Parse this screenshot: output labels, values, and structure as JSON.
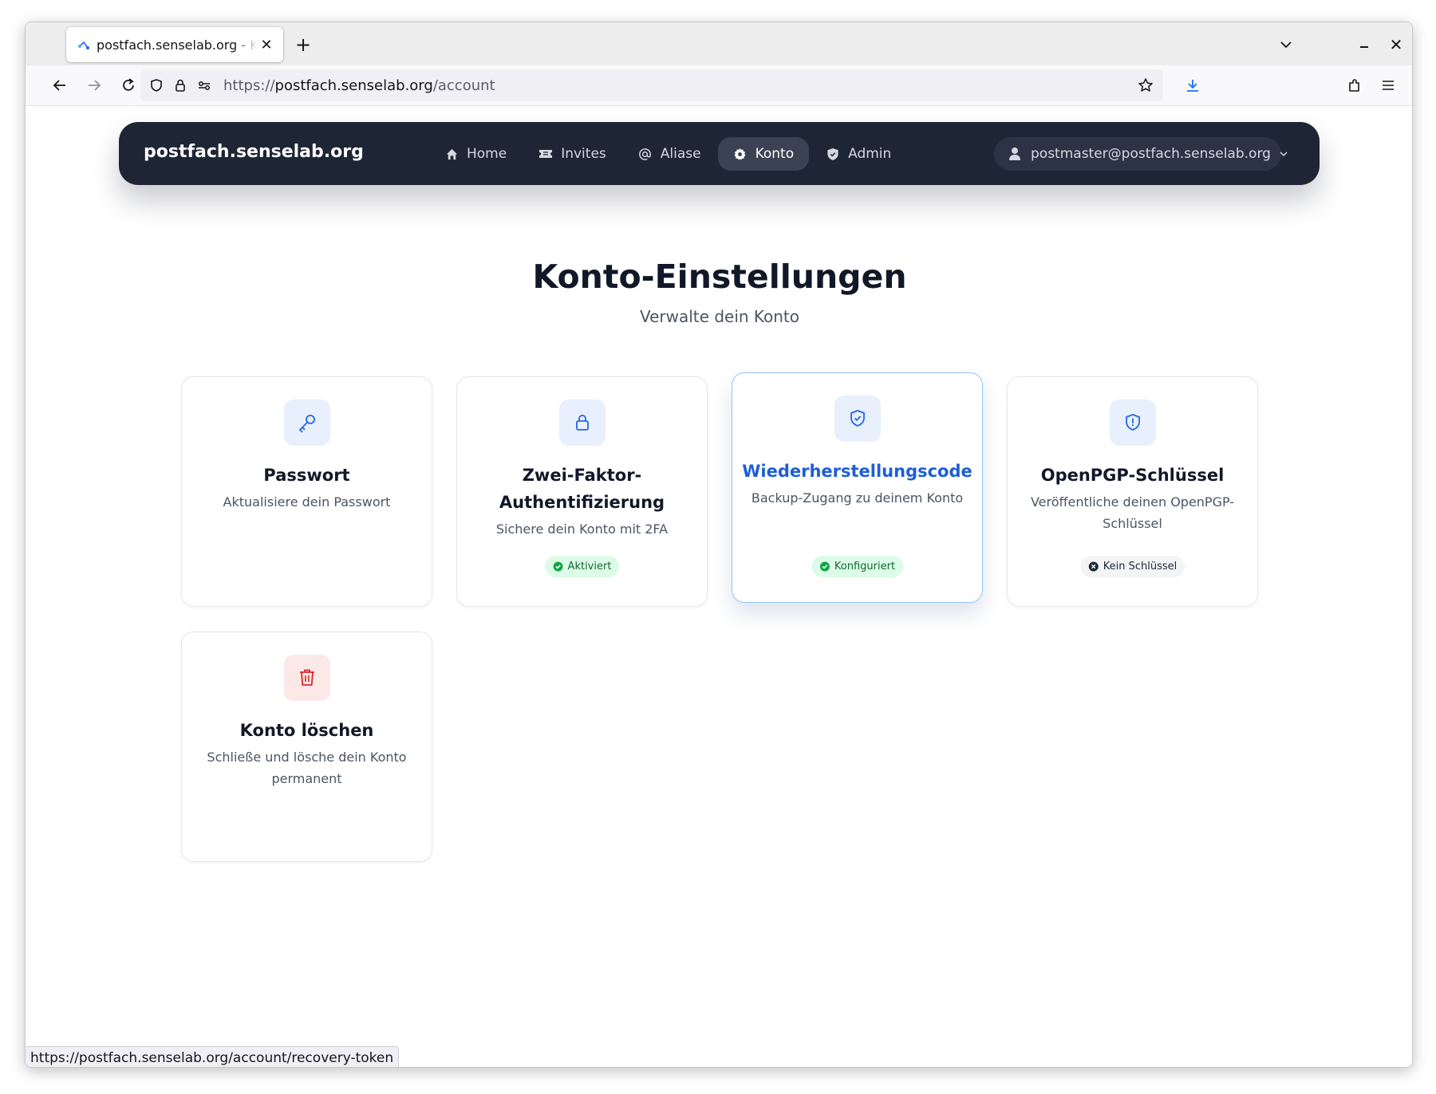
{
  "browser": {
    "tab_title": "postfach.senselab.org - K",
    "url_prefix": "https://",
    "url_host": "postfach.senselab.org",
    "url_path": "/account",
    "status_url": "https://postfach.senselab.org/account/recovery-token"
  },
  "header": {
    "brand": "postfach.senselab.org",
    "nav": [
      {
        "label": "Home",
        "icon": "home-icon"
      },
      {
        "label": "Invites",
        "icon": "ticket-icon"
      },
      {
        "label": "Aliase",
        "icon": "at-icon"
      },
      {
        "label": "Konto",
        "icon": "gear-icon",
        "active": true
      },
      {
        "label": "Admin",
        "icon": "shield-icon"
      }
    ],
    "user_email": "postmaster@postfach.senselab.org"
  },
  "page": {
    "title": "Konto-Einstellungen",
    "subtitle": "Verwalte dein Konto"
  },
  "cards": [
    {
      "title": "Passwort",
      "desc": "Aktualisiere dein Passwort",
      "icon": "key-icon"
    },
    {
      "title_line1": "Zwei-Faktor-",
      "title_line2": "Authentifizierung",
      "desc": "Sichere dein Konto mit 2FA",
      "icon": "lock-icon",
      "badge": "Aktiviert",
      "badge_color": "#166534"
    },
    {
      "title": "Wiederherstellungscode",
      "desc": "Backup-Zugang zu deinem Konto",
      "icon": "shield-check-icon",
      "badge": "Konfiguriert",
      "badge_color": "#166534"
    },
    {
      "title": "OpenPGP-Schlüssel",
      "desc_line1": "Veröffentliche deinen OpenPGP-",
      "desc_line2": "Schlüssel",
      "icon": "shield-alert-icon",
      "badge": "Kein Schlüssel",
      "badge_color": "#1f2937"
    },
    {
      "title": "Konto löschen",
      "desc_line1": "Schließe und lösche dein Konto",
      "desc_line2": "permanent",
      "icon": "trash-icon"
    }
  ],
  "colors": {
    "header_bg": "#1e2535",
    "accent_blue": "#1d5ed8",
    "danger_red": "#dc2626",
    "success_green": "#166534"
  }
}
